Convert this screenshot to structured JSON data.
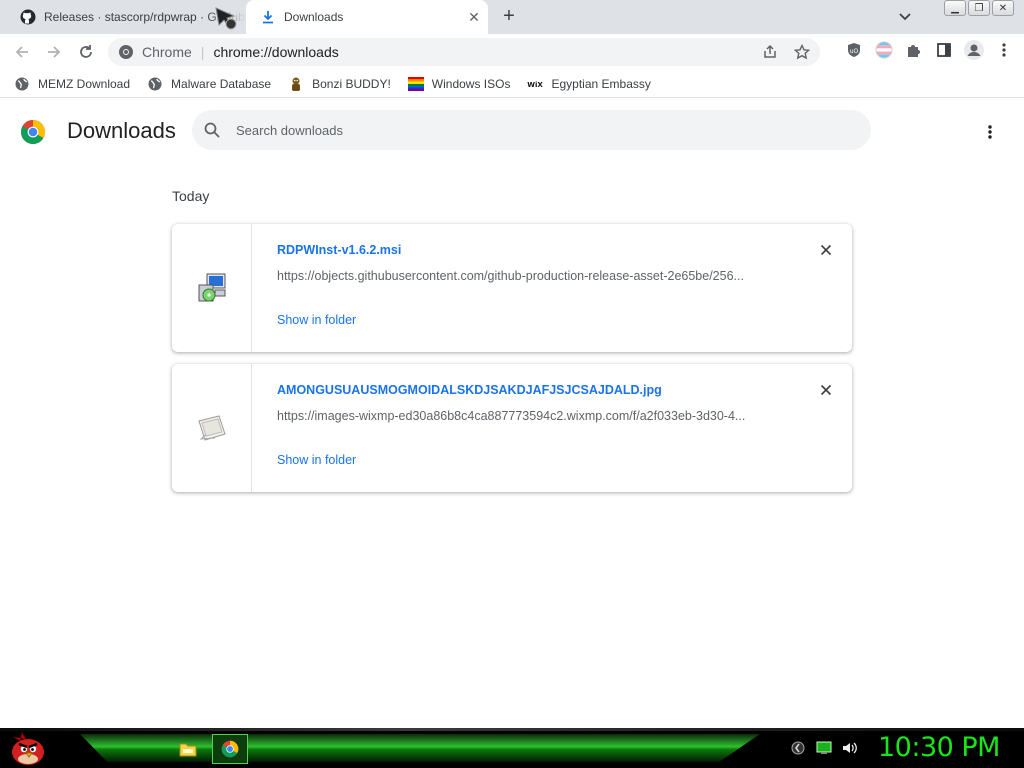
{
  "tabs": [
    {
      "title": "Releases · stascorp/rdpwrap · GitHub",
      "icon": "github-icon",
      "active": false
    },
    {
      "title": "Downloads",
      "icon": "download-icon",
      "active": true
    }
  ],
  "window_buttons": [
    "minimize",
    "restore",
    "close"
  ],
  "toolbar": {
    "omnibox_scheme_label": "Chrome",
    "omnibox_url": "chrome://downloads"
  },
  "bookmarks": [
    {
      "label": "MEMZ Download",
      "icon": "globe-icon"
    },
    {
      "label": "Malware Database",
      "icon": "globe-icon"
    },
    {
      "label": "Bonzi BUDDY!",
      "icon": "bonzi-icon"
    },
    {
      "label": "Windows ISOs",
      "icon": "rainbow-flag-icon"
    },
    {
      "label": "Egyptian Embassy",
      "icon": "wix-icon"
    }
  ],
  "downloads_page": {
    "title": "Downloads",
    "search_placeholder": "Search downloads",
    "section_label": "Today",
    "items": [
      {
        "filename": "RDPWInst-v1.6.2.msi",
        "url": "https://objects.githubusercontent.com/github-production-release-asset-2e65be/256...",
        "action": "Show in folder",
        "icon": "msi-installer-icon"
      },
      {
        "filename": "AMONGUSUAUSMOGMOIDALSKDJSAKDJAFJSJCSAJDALD.jpg",
        "url": "https://images-wixmp-ed30a86b8c4ca887773594c2.wixmp.com/f/a2f033eb-3d30-4...",
        "action": "Show in folder",
        "icon": "image-file-icon"
      }
    ]
  },
  "taskbar": {
    "clock": "10:30 PM",
    "accent": "#19e619"
  },
  "colors": {
    "link": "#1a73e8",
    "tabstrip": "#dee1e6",
    "omnibox": "#f1f3f4"
  }
}
